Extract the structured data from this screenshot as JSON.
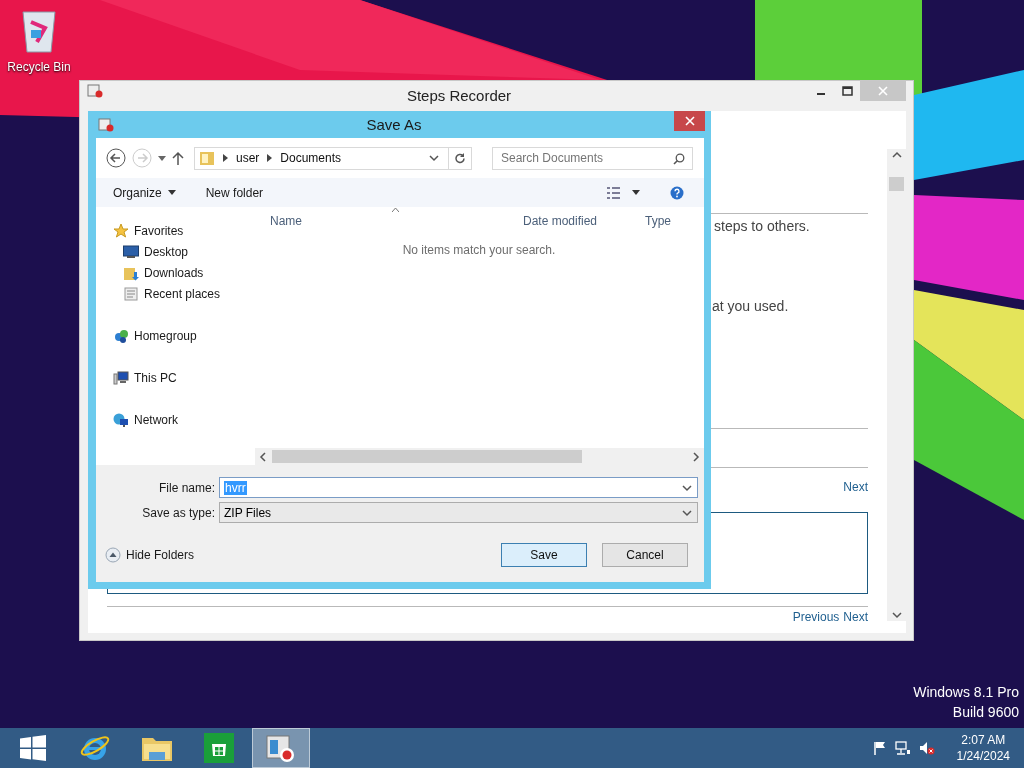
{
  "desktop": {
    "icons": [
      {
        "label": "Recycle Bin"
      }
    ],
    "edition": "Windows 8.1 Pro",
    "build": "Build 9600"
  },
  "steps_recorder": {
    "title": "Steps Recorder",
    "texts": [
      "steps to others.",
      "at you used."
    ],
    "link_top": "Next",
    "links_bottom": [
      "Previous",
      "Next"
    ]
  },
  "save_as": {
    "title": "Save As",
    "breadcrumb": [
      "user",
      "Documents"
    ],
    "search": {
      "placeholder": "Search Documents"
    },
    "toolbar": [
      "Organize",
      "New folder"
    ],
    "nav": [
      {
        "label": "Favorites",
        "kind": "favorites",
        "children": [
          {
            "label": "Desktop",
            "kind": "desktop"
          },
          {
            "label": "Downloads",
            "kind": "downloads"
          },
          {
            "label": "Recent places",
            "kind": "recent"
          }
        ]
      },
      {
        "label": "Homegroup",
        "kind": "homegroup"
      },
      {
        "label": "This PC",
        "kind": "pc"
      },
      {
        "label": "Network",
        "kind": "network"
      }
    ],
    "columns": [
      "Name",
      "Date modified",
      "Type"
    ],
    "empty_message": "No items match your search.",
    "file_name": {
      "label": "File name:",
      "value": "hvrr",
      "highlighted": true
    },
    "save_type": {
      "label": "Save as type:",
      "value": "ZIP Files"
    },
    "hide_folders": "Hide Folders",
    "buttons": [
      {
        "label": "Save",
        "focused": true
      },
      {
        "label": "Cancel",
        "focused": false
      }
    ]
  },
  "taskbar": {
    "apps": [
      {
        "kind": "ie",
        "selected": false
      },
      {
        "kind": "explorer",
        "selected": false
      },
      {
        "kind": "store",
        "selected": false
      },
      {
        "kind": "steps",
        "selected": true
      }
    ],
    "clock": {
      "time": "2:07 AM",
      "date": "1/24/2024"
    }
  }
}
